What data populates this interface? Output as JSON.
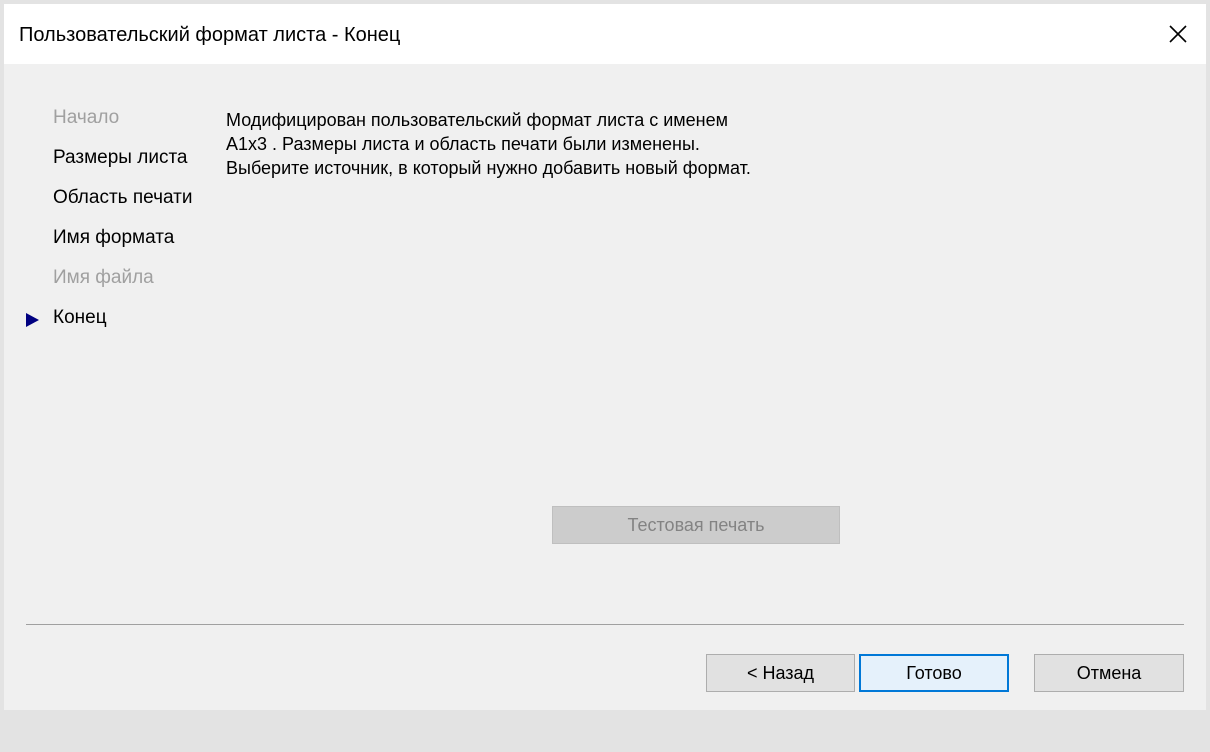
{
  "window": {
    "title": "Пользовательский формат листа - Конец"
  },
  "icons": {
    "close": "close-icon",
    "current_step": "triangle-right-icon"
  },
  "colors": {
    "accent": "#0078d7",
    "step_arrow": "#000080",
    "disabled_text": "#a0a0a0"
  },
  "steps": [
    {
      "label": "Начало",
      "enabled": false
    },
    {
      "label": "Размеры листа",
      "enabled": true
    },
    {
      "label": "Область печати",
      "enabled": true
    },
    {
      "label": "Имя формата",
      "enabled": true
    },
    {
      "label": "Имя файла",
      "enabled": false
    },
    {
      "label": "Конец",
      "enabled": true,
      "current": true
    }
  ],
  "message": {
    "line1": "Модифицирован пользовательский формат листа с именем",
    "line2": "A1x3 . Размеры листа и область печати были изменены.",
    "line3": "Выберите источник, в который нужно добавить новый формат."
  },
  "buttons": {
    "test_print": "Тестовая печать",
    "back": "< Назад",
    "finish": "Готово",
    "cancel": "Отмена"
  }
}
